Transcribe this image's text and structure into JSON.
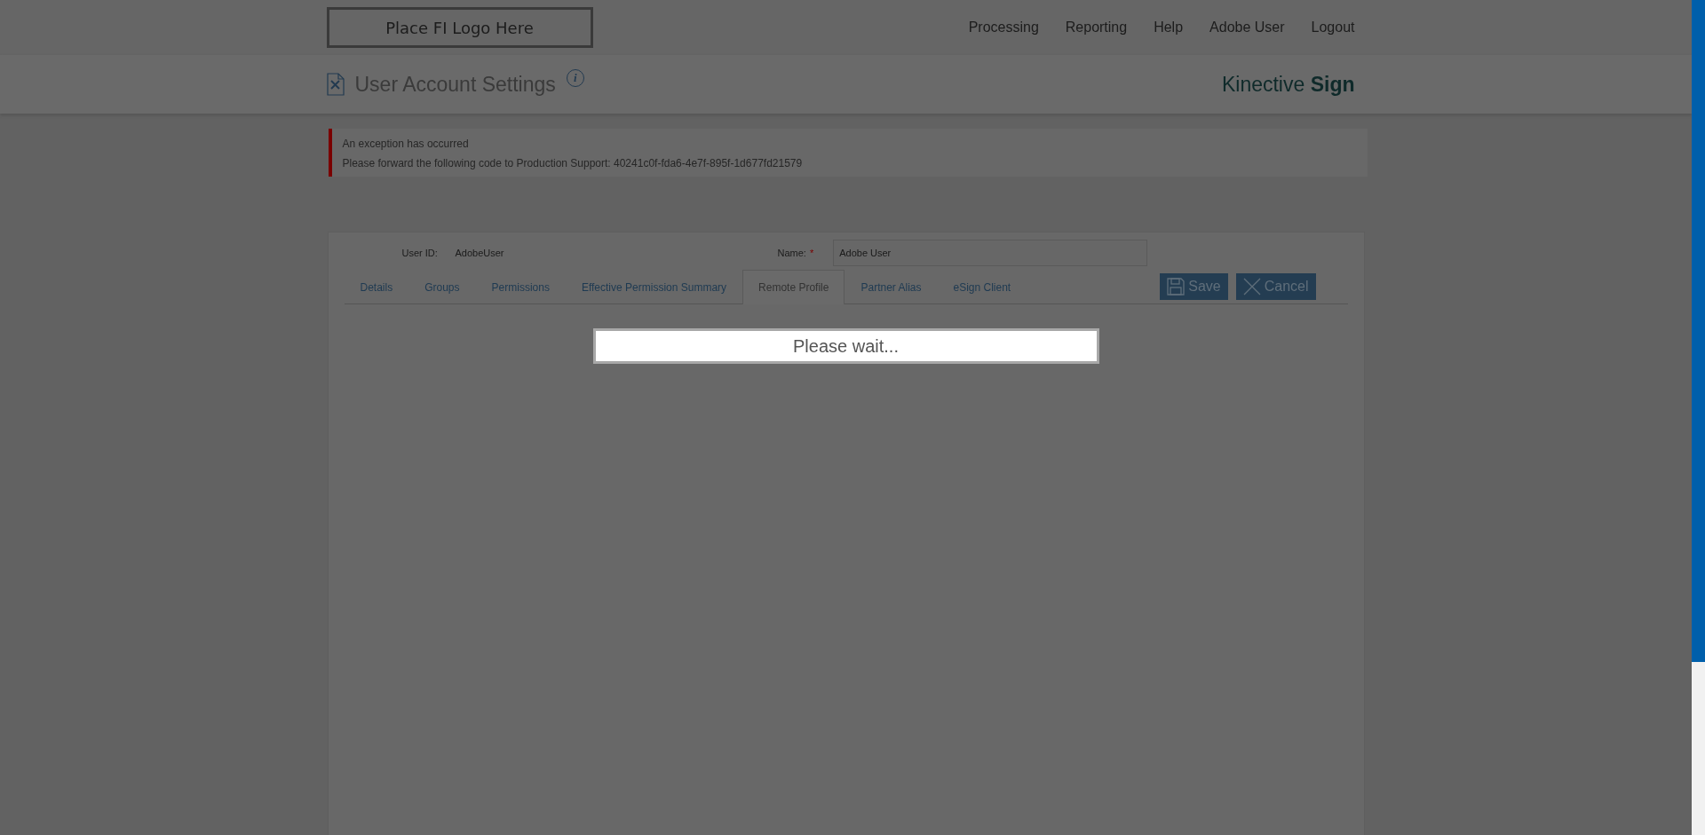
{
  "header": {
    "logo_text": "Place FI Logo Here",
    "nav": [
      "Processing",
      "Reporting",
      "Help",
      "Adobe User",
      "Logout"
    ]
  },
  "title_bar": {
    "title": "User Account Settings",
    "info": "i",
    "brand": {
      "light": "Kinective",
      "bold": "Sign"
    }
  },
  "alert": {
    "lines": [
      "An exception has occurred",
      "Please forward the following code to Production Support: 40241c0f-fda6-4e7f-895f-1d677fd21579"
    ]
  },
  "form": {
    "user_id_label": "User ID:",
    "user_id": "AdobeUser",
    "name_label": "Name:",
    "required_mark": "*",
    "name_value": "Adobe User"
  },
  "tabs": [
    {
      "label": "Details",
      "selected": false
    },
    {
      "label": "Groups",
      "selected": false
    },
    {
      "label": "Permissions",
      "selected": false
    },
    {
      "label": "Effective Permission Summary",
      "selected": false
    },
    {
      "label": "Remote Profile",
      "selected": true
    },
    {
      "label": "Partner Alias",
      "selected": false
    },
    {
      "label": "eSign Client",
      "selected": false
    }
  ],
  "buttons": [
    {
      "kind": "save",
      "label": "Save"
    },
    {
      "kind": "cancel",
      "label": "Cancel"
    }
  ],
  "loading": {
    "text": "Please wait..."
  }
}
